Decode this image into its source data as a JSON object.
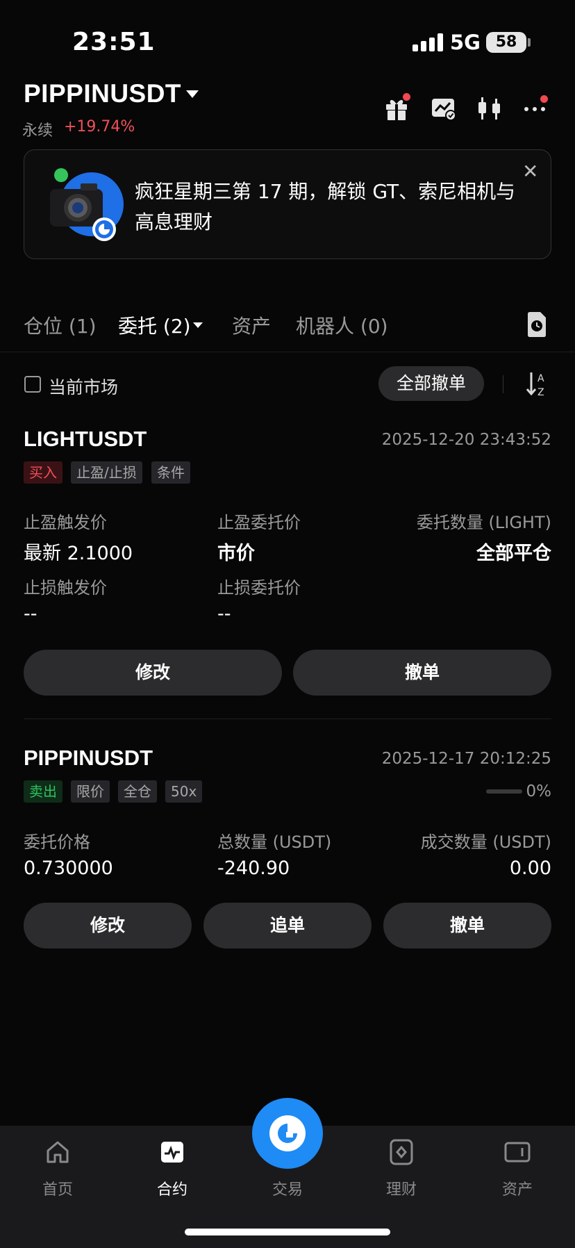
{
  "status_bar": {
    "time": "23:51",
    "network": "5G",
    "battery": "58"
  },
  "header": {
    "symbol": "PIPPINUSDT",
    "contract_type": "永续",
    "change": "+19.74%",
    "icons": [
      "gift-icon",
      "chart-check-icon",
      "candlestick-icon",
      "more-icon"
    ]
  },
  "banner": {
    "text": "疯狂星期三第 17 期，解锁 GT、索尼相机与高息理财",
    "close": "✕"
  },
  "tabs": [
    {
      "label": "仓位 (1)"
    },
    {
      "label": "委托 (2)"
    },
    {
      "label": "资产"
    },
    {
      "label": "机器人 (0)"
    }
  ],
  "filter": {
    "current_market_label": "当前市场",
    "cancel_all_label": "全部撤单"
  },
  "orders": [
    {
      "symbol": "LIGHTUSDT",
      "time": "2025-12-20 23:43:52",
      "tags": [
        "买入",
        "止盈/止损",
        "条件"
      ],
      "fields": [
        {
          "label": "止盈触发价",
          "value": "最新 2.1000"
        },
        {
          "label": "止盈委托价",
          "value": "市价"
        },
        {
          "label": "委托数量 (LIGHT)",
          "value": "全部平仓"
        },
        {
          "label": "止损触发价",
          "value": "--"
        },
        {
          "label": "止损委托价",
          "value": "--"
        }
      ],
      "actions": [
        "修改",
        "撤单"
      ]
    },
    {
      "symbol": "PIPPINUSDT",
      "time": "2025-12-17 20:12:25",
      "tags": [
        "卖出",
        "限价",
        "全仓",
        "50x"
      ],
      "progress_label": "0%",
      "progress": 0,
      "fields": [
        {
          "label": "委托价格",
          "value": "0.730000"
        },
        {
          "label": "总数量 (USDT)",
          "value": "-240.90"
        },
        {
          "label": "成交数量 (USDT)",
          "value": "0.00"
        }
      ],
      "actions": [
        "修改",
        "追单",
        "撤单"
      ]
    }
  ],
  "bottom_nav": [
    {
      "label": "首页",
      "icon": "home-icon"
    },
    {
      "label": "合约",
      "icon": "contract-icon"
    },
    {
      "label": "交易",
      "icon": "trade-logo-icon"
    },
    {
      "label": "理财",
      "icon": "finance-icon"
    },
    {
      "label": "资产",
      "icon": "wallet-icon"
    }
  ],
  "colors": {
    "up": "#f0505a",
    "down": "#2fc35f",
    "accent": "#1f8bf5"
  }
}
